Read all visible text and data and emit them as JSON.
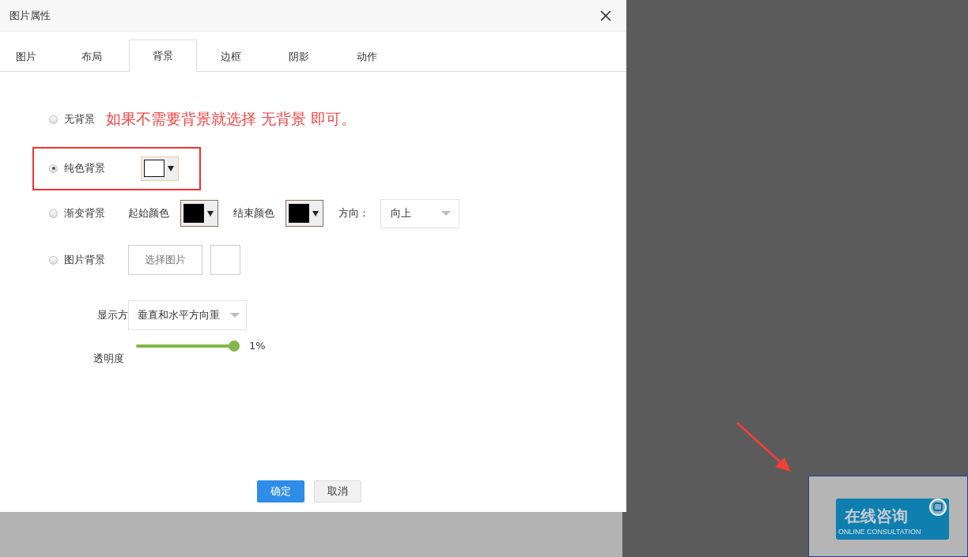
{
  "dialog": {
    "title": "图片属性",
    "tabs": [
      {
        "label": "图片",
        "selected": false
      },
      {
        "label": "布局",
        "selected": false
      },
      {
        "label": "背景",
        "selected": true
      },
      {
        "label": "边框",
        "selected": false
      },
      {
        "label": "阴影",
        "selected": false
      },
      {
        "label": "动作",
        "selected": false
      }
    ],
    "options": [
      {
        "kind": "none",
        "label": "无背景",
        "selected": false,
        "highlighted": false,
        "note": "如果不需要背景就选择 无背景 即可。"
      },
      {
        "kind": "solid",
        "label": "纯色背景",
        "selected": true,
        "highlighted": true,
        "color": "#ffffff"
      },
      {
        "kind": "gradient",
        "label": "渐变背景",
        "selected": false,
        "highlighted": false,
        "start": {
          "label": "起始颜色",
          "color": "#000000"
        },
        "end": {
          "label": "结束颜色",
          "color": "#000000"
        },
        "direction_label": "方向：",
        "direction": "向上"
      },
      {
        "kind": "image",
        "label": "图片背景",
        "selected": false,
        "highlighted": false,
        "button": "选择图片"
      }
    ],
    "display": {
      "label": "显示方",
      "value": "垂直和水平方向重"
    },
    "opacity": {
      "label": "透明度",
      "level": 1.0,
      "reading": "1%"
    },
    "buttons": [
      {
        "label": "确定",
        "primary": true
      },
      {
        "label": "取消",
        "primary": false
      }
    ]
  },
  "canvas": {
    "banner_title": "在线咨询",
    "banner_subtitle": "ONLINE CONSULTATION"
  }
}
